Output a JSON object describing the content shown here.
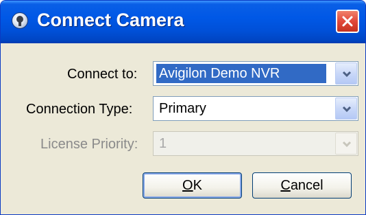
{
  "window": {
    "title": "Connect Camera",
    "icon": "camera-icon",
    "close_icon": "close-icon"
  },
  "form": {
    "connect_to": {
      "label": "Connect to:",
      "value": "Avigilon Demo NVR",
      "selected": true,
      "enabled": true
    },
    "connection_type": {
      "label": "Connection Type:",
      "value": "Primary",
      "enabled": true
    },
    "license_priority": {
      "label": "License Priority:",
      "value": "1",
      "enabled": false
    }
  },
  "buttons": {
    "ok": {
      "mnemonic": "O",
      "rest": "K"
    },
    "cancel": {
      "mnemonic": "C",
      "rest": "ancel"
    }
  },
  "colors": {
    "titlebar": "#0058e6",
    "selection": "#316ac5",
    "close": "#e2493a",
    "dialog_bg": "#ece9d8"
  }
}
